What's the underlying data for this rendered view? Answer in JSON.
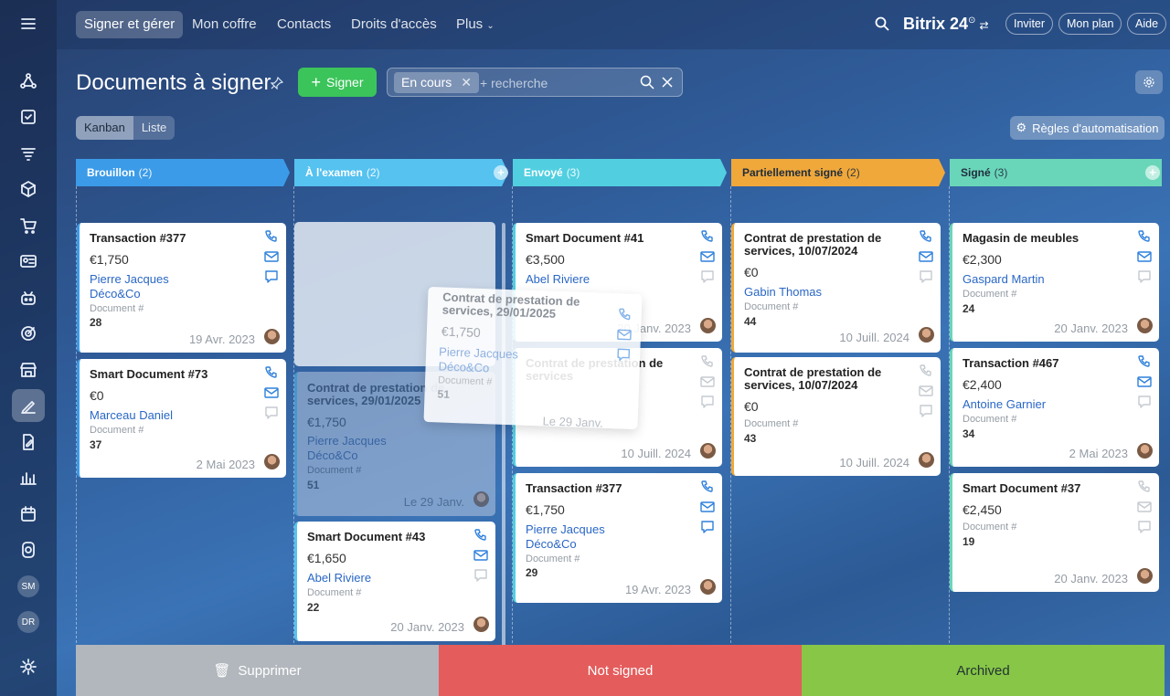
{
  "sidebar": {
    "items": [
      "menu-icon",
      "crm-icon",
      "tasks-icon",
      "filter-icon",
      "box-icon",
      "cart-icon",
      "contact-card-icon",
      "robot-icon",
      "target-icon",
      "shop-icon",
      "sign-icon",
      "doc-edit-icon",
      "analytics-icon",
      "calendar-icon",
      "disk-icon"
    ],
    "avatars": [
      "SM",
      "DR"
    ]
  },
  "topnav": {
    "items": [
      "Signer et gérer",
      "Mon coffre",
      "Contacts",
      "Droits d'accès",
      "Plus"
    ],
    "logo": "Bitrix 24",
    "invite": "Inviter",
    "plan": "Mon plan",
    "help": "Aide"
  },
  "toolbar": {
    "title": "Documents à signer",
    "sign_label": "Signer",
    "filter_chip": "En cours",
    "search_placeholder": "+ recherche"
  },
  "views": {
    "kanban": "Kanban",
    "list": "Liste",
    "automation": "Règles d'automatisation"
  },
  "columns": [
    {
      "name": "Brouillon",
      "count": "(2)",
      "color": "#3b9be8"
    },
    {
      "name": "À l'examen",
      "count": "(2)",
      "color": "#55c2f0"
    },
    {
      "name": "Envoyé",
      "count": "(3)",
      "color": "#51cfe0"
    },
    {
      "name": "Partiellement signé",
      "count": "(2)",
      "color": "#f0a83a"
    },
    {
      "name": "Signé",
      "count": "(3)",
      "color": "#6ad6b9"
    }
  ],
  "doc_label": "Document #",
  "cards": [
    {
      "title": "Transaction #377",
      "amount": "€1,750",
      "person": "Pierre Jacques",
      "company": "Déco&Co",
      "doc": "28",
      "date": "19 Avr. 2023"
    },
    {
      "title": "Smart Document #73",
      "amount": "€0",
      "person": "Marceau Daniel",
      "doc": "37",
      "date": "2 Mai 2023"
    },
    {
      "title": "Contrat de prestation de services, 29/01/2025",
      "amount": "€1,750",
      "person": "Pierre Jacques",
      "company": "Déco&Co",
      "doc": "51",
      "date": "Le 29 Janv."
    },
    {
      "title": "Smart Document #43",
      "amount": "€1,650",
      "person": "Abel Riviere",
      "doc": "22",
      "date": "20 Janv. 2023"
    },
    {
      "title": "Smart Document #41",
      "amount": "€3,500",
      "person": "Abel Riviere",
      "date": "20 Janv. 2023"
    },
    {
      "title": "Contrat de prestation de services",
      "date": "10 Juill. 2024"
    },
    {
      "title": "Transaction #377",
      "amount": "€1,750",
      "person": "Pierre Jacques",
      "company": "Déco&Co",
      "doc": "29",
      "date": "19 Avr. 2023"
    },
    {
      "title": "Contrat de prestation de services, 10/07/2024",
      "amount": "€0",
      "person": "Gabin Thomas",
      "doc": "44",
      "date": "10 Juill. 2024"
    },
    {
      "title": "Contrat de prestation de services, 10/07/2024",
      "amount": "€0",
      "doc": "43",
      "date": "10 Juill. 2024"
    },
    {
      "title": "Magasin de meubles",
      "amount": "€2,300",
      "person": "Gaspard Martin",
      "doc": "24",
      "date": "20 Janv. 2023"
    },
    {
      "title": "Transaction #467",
      "amount": "€2,400",
      "person": "Antoine Garnier",
      "doc": "34",
      "date": "2 Mai 2023"
    },
    {
      "title": "Smart Document #37",
      "amount": "€2,450",
      "doc": "19",
      "date": "20 Janv. 2023"
    }
  ],
  "dropzones": {
    "delete": "Supprimer",
    "not_signed": "Not signed",
    "archived": "Archived"
  }
}
